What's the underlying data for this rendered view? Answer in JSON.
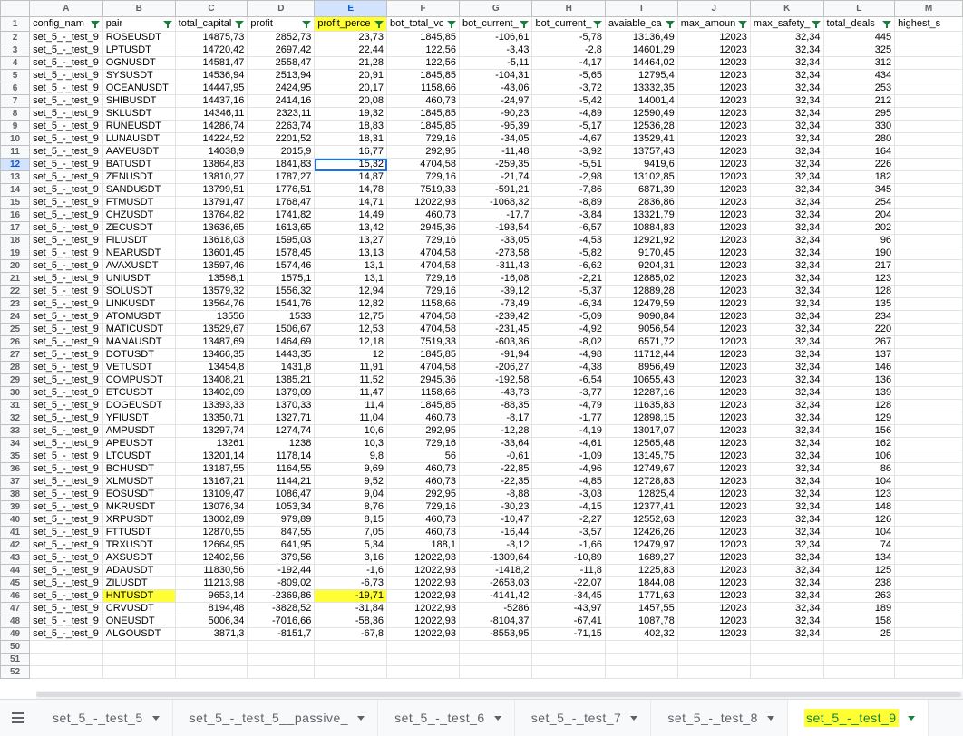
{
  "columns": [
    "A",
    "B",
    "C",
    "D",
    "E",
    "F",
    "G",
    "H",
    "I",
    "J",
    "K",
    "L",
    "M"
  ],
  "header": [
    "config_nam",
    "pair",
    "total_capital",
    "profit",
    "profit_perce",
    "bot_total_vc",
    "bot_current_",
    "bot_current_",
    "avaiable_ca",
    "max_amoun",
    "max_safety_",
    "total_deals",
    "highest_s"
  ],
  "rows": [
    [
      "set_5_-_test_9",
      "ROSEUSDT",
      "14875,73",
      "2852,73",
      "23,73",
      "1845,85",
      "-106,61",
      "-5,78",
      "13136,49",
      "12023",
      "32,34",
      "445"
    ],
    [
      "set_5_-_test_9",
      "LPTUSDT",
      "14720,42",
      "2697,42",
      "22,44",
      "122,56",
      "-3,43",
      "-2,8",
      "14601,29",
      "12023",
      "32,34",
      "325"
    ],
    [
      "set_5_-_test_9",
      "OGNUSDT",
      "14581,47",
      "2558,47",
      "21,28",
      "122,56",
      "-5,11",
      "-4,17",
      "14464,02",
      "12023",
      "32,34",
      "312"
    ],
    [
      "set_5_-_test_9",
      "SYSUSDT",
      "14536,94",
      "2513,94",
      "20,91",
      "1845,85",
      "-104,31",
      "-5,65",
      "12795,4",
      "12023",
      "32,34",
      "434"
    ],
    [
      "set_5_-_test_9",
      "OCEANUSDT",
      "14447,95",
      "2424,95",
      "20,17",
      "1158,66",
      "-43,06",
      "-3,72",
      "13332,35",
      "12023",
      "32,34",
      "253"
    ],
    [
      "set_5_-_test_9",
      "SHIBUSDT",
      "14437,16",
      "2414,16",
      "20,08",
      "460,73",
      "-24,97",
      "-5,42",
      "14001,4",
      "12023",
      "32,34",
      "212"
    ],
    [
      "set_5_-_test_9",
      "SKLUSDT",
      "14346,11",
      "2323,11",
      "19,32",
      "1845,85",
      "-90,23",
      "-4,89",
      "12590,49",
      "12023",
      "32,34",
      "295"
    ],
    [
      "set_5_-_test_9",
      "RUNEUSDT",
      "14286,74",
      "2263,74",
      "18,83",
      "1845,85",
      "-95,39",
      "-5,17",
      "12536,28",
      "12023",
      "32,34",
      "330"
    ],
    [
      "set_5_-_test_9",
      "LUNAUSDT",
      "14224,52",
      "2201,52",
      "18,31",
      "729,16",
      "-34,05",
      "-4,67",
      "13529,41",
      "12023",
      "32,34",
      "280"
    ],
    [
      "set_5_-_test_9",
      "AAVEUSDT",
      "14038,9",
      "2015,9",
      "16,77",
      "292,95",
      "-11,48",
      "-3,92",
      "13757,43",
      "12023",
      "32,34",
      "164"
    ],
    [
      "set_5_-_test_9",
      "BATUSDT",
      "13864,83",
      "1841,83",
      "15,32",
      "4704,58",
      "-259,35",
      "-5,51",
      "9419,6",
      "12023",
      "32,34",
      "226"
    ],
    [
      "set_5_-_test_9",
      "ZENUSDT",
      "13810,27",
      "1787,27",
      "14,87",
      "729,16",
      "-21,74",
      "-2,98",
      "13102,85",
      "12023",
      "32,34",
      "182"
    ],
    [
      "set_5_-_test_9",
      "SANDUSDT",
      "13799,51",
      "1776,51",
      "14,78",
      "7519,33",
      "-591,21",
      "-7,86",
      "6871,39",
      "12023",
      "32,34",
      "345"
    ],
    [
      "set_5_-_test_9",
      "FTMUSDT",
      "13791,47",
      "1768,47",
      "14,71",
      "12022,93",
      "-1068,32",
      "-8,89",
      "2836,86",
      "12023",
      "32,34",
      "254"
    ],
    [
      "set_5_-_test_9",
      "CHZUSDT",
      "13764,82",
      "1741,82",
      "14,49",
      "460,73",
      "-17,7",
      "-3,84",
      "13321,79",
      "12023",
      "32,34",
      "204"
    ],
    [
      "set_5_-_test_9",
      "ZECUSDT",
      "13636,65",
      "1613,65",
      "13,42",
      "2945,36",
      "-193,54",
      "-6,57",
      "10884,83",
      "12023",
      "32,34",
      "202"
    ],
    [
      "set_5_-_test_9",
      "FILUSDT",
      "13618,03",
      "1595,03",
      "13,27",
      "729,16",
      "-33,05",
      "-4,53",
      "12921,92",
      "12023",
      "32,34",
      "96"
    ],
    [
      "set_5_-_test_9",
      "NEARUSDT",
      "13601,45",
      "1578,45",
      "13,13",
      "4704,58",
      "-273,58",
      "-5,82",
      "9170,45",
      "12023",
      "32,34",
      "190"
    ],
    [
      "set_5_-_test_9",
      "AVAXUSDT",
      "13597,46",
      "1574,46",
      "13,1",
      "4704,58",
      "-311,43",
      "-6,62",
      "9204,31",
      "12023",
      "32,34",
      "217"
    ],
    [
      "set_5_-_test_9",
      "UNIUSDT",
      "13598,1",
      "1575,1",
      "13,1",
      "729,16",
      "-16,08",
      "-2,21",
      "12885,02",
      "12023",
      "32,34",
      "123"
    ],
    [
      "set_5_-_test_9",
      "SOLUSDT",
      "13579,32",
      "1556,32",
      "12,94",
      "729,16",
      "-39,12",
      "-5,37",
      "12889,28",
      "12023",
      "32,34",
      "128"
    ],
    [
      "set_5_-_test_9",
      "LINKUSDT",
      "13564,76",
      "1541,76",
      "12,82",
      "1158,66",
      "-73,49",
      "-6,34",
      "12479,59",
      "12023",
      "32,34",
      "135"
    ],
    [
      "set_5_-_test_9",
      "ATOMUSDT",
      "13556",
      "1533",
      "12,75",
      "4704,58",
      "-239,42",
      "-5,09",
      "9090,84",
      "12023",
      "32,34",
      "234"
    ],
    [
      "set_5_-_test_9",
      "MATICUSDT",
      "13529,67",
      "1506,67",
      "12,53",
      "4704,58",
      "-231,45",
      "-4,92",
      "9056,54",
      "12023",
      "32,34",
      "220"
    ],
    [
      "set_5_-_test_9",
      "MANAUSDT",
      "13487,69",
      "1464,69",
      "12,18",
      "7519,33",
      "-603,36",
      "-8,02",
      "6571,72",
      "12023",
      "32,34",
      "267"
    ],
    [
      "set_5_-_test_9",
      "DOTUSDT",
      "13466,35",
      "1443,35",
      "12",
      "1845,85",
      "-91,94",
      "-4,98",
      "11712,44",
      "12023",
      "32,34",
      "137"
    ],
    [
      "set_5_-_test_9",
      "VETUSDT",
      "13454,8",
      "1431,8",
      "11,91",
      "4704,58",
      "-206,27",
      "-4,38",
      "8956,49",
      "12023",
      "32,34",
      "146"
    ],
    [
      "set_5_-_test_9",
      "COMPUSDT",
      "13408,21",
      "1385,21",
      "11,52",
      "2945,36",
      "-192,58",
      "-6,54",
      "10655,43",
      "12023",
      "32,34",
      "136"
    ],
    [
      "set_5_-_test_9",
      "ETCUSDT",
      "13402,09",
      "1379,09",
      "11,47",
      "1158,66",
      "-43,73",
      "-3,77",
      "12287,16",
      "12023",
      "32,34",
      "139"
    ],
    [
      "set_5_-_test_9",
      "DOGEUSDT",
      "13393,33",
      "1370,33",
      "11,4",
      "1845,85",
      "-88,35",
      "-4,79",
      "11635,83",
      "12023",
      "32,34",
      "128"
    ],
    [
      "set_5_-_test_9",
      "YFIUSDT",
      "13350,71",
      "1327,71",
      "11,04",
      "460,73",
      "-8,17",
      "-1,77",
      "12898,15",
      "12023",
      "32,34",
      "129"
    ],
    [
      "set_5_-_test_9",
      "AMPUSDT",
      "13297,74",
      "1274,74",
      "10,6",
      "292,95",
      "-12,28",
      "-4,19",
      "13017,07",
      "12023",
      "32,34",
      "156"
    ],
    [
      "set_5_-_test_9",
      "APEUSDT",
      "13261",
      "1238",
      "10,3",
      "729,16",
      "-33,64",
      "-4,61",
      "12565,48",
      "12023",
      "32,34",
      "162"
    ],
    [
      "set_5_-_test_9",
      "LTCUSDT",
      "13201,14",
      "1178,14",
      "9,8",
      "56",
      "-0,61",
      "-1,09",
      "13145,75",
      "12023",
      "32,34",
      "106"
    ],
    [
      "set_5_-_test_9",
      "BCHUSDT",
      "13187,55",
      "1164,55",
      "9,69",
      "460,73",
      "-22,85",
      "-4,96",
      "12749,67",
      "12023",
      "32,34",
      "86"
    ],
    [
      "set_5_-_test_9",
      "XLMUSDT",
      "13167,21",
      "1144,21",
      "9,52",
      "460,73",
      "-22,35",
      "-4,85",
      "12728,83",
      "12023",
      "32,34",
      "104"
    ],
    [
      "set_5_-_test_9",
      "EOSUSDT",
      "13109,47",
      "1086,47",
      "9,04",
      "292,95",
      "-8,88",
      "-3,03",
      "12825,4",
      "12023",
      "32,34",
      "123"
    ],
    [
      "set_5_-_test_9",
      "MKRUSDT",
      "13076,34",
      "1053,34",
      "8,76",
      "729,16",
      "-30,23",
      "-4,15",
      "12377,41",
      "12023",
      "32,34",
      "148"
    ],
    [
      "set_5_-_test_9",
      "XRPUSDT",
      "13002,89",
      "979,89",
      "8,15",
      "460,73",
      "-10,47",
      "-2,27",
      "12552,63",
      "12023",
      "32,34",
      "126"
    ],
    [
      "set_5_-_test_9",
      "FTTUSDT",
      "12870,55",
      "847,55",
      "7,05",
      "460,73",
      "-16,44",
      "-3,57",
      "12426,26",
      "12023",
      "32,34",
      "104"
    ],
    [
      "set_5_-_test_9",
      "TRXUSDT",
      "12664,95",
      "641,95",
      "5,34",
      "188,1",
      "-3,12",
      "-1,66",
      "12479,97",
      "12023",
      "32,34",
      "74"
    ],
    [
      "set_5_-_test_9",
      "AXSUSDT",
      "12402,56",
      "379,56",
      "3,16",
      "12022,93",
      "-1309,64",
      "-10,89",
      "1689,27",
      "12023",
      "32,34",
      "134"
    ],
    [
      "set_5_-_test_9",
      "ADAUSDT",
      "11830,56",
      "-192,44",
      "-1,6",
      "12022,93",
      "-1418,2",
      "-11,8",
      "1225,83",
      "12023",
      "32,34",
      "125"
    ],
    [
      "set_5_-_test_9",
      "ZILUSDT",
      "11213,98",
      "-809,02",
      "-6,73",
      "12022,93",
      "-2653,03",
      "-22,07",
      "1844,08",
      "12023",
      "32,34",
      "238"
    ],
    [
      "set_5_-_test_9",
      "HNTUSDT",
      "9653,14",
      "-2369,86",
      "-19,71",
      "12022,93",
      "-4141,42",
      "-34,45",
      "1771,63",
      "12023",
      "32,34",
      "263"
    ],
    [
      "set_5_-_test_9",
      "CRVUSDT",
      "8194,48",
      "-3828,52",
      "-31,84",
      "12022,93",
      "-5286",
      "-43,97",
      "1457,55",
      "12023",
      "32,34",
      "189"
    ],
    [
      "set_5_-_test_9",
      "ONEUSDT",
      "5006,34",
      "-7016,66",
      "-58,36",
      "12022,93",
      "-8104,37",
      "-67,41",
      "1087,78",
      "12023",
      "32,34",
      "158"
    ],
    [
      "set_5_-_test_9",
      "ALGOUSDT",
      "3871,3",
      "-8151,7",
      "-67,8",
      "12022,93",
      "-8553,95",
      "-71,15",
      "402,32",
      "12023",
      "32,34",
      "25"
    ]
  ],
  "empty_row_numbers": [
    50,
    51,
    52
  ],
  "selected_cell": {
    "row": 12,
    "col": "E"
  },
  "highlighted_row": 46,
  "highlight_color": "#ffff33",
  "tabs": [
    {
      "label": "set_5_-_test_5",
      "active": false
    },
    {
      "label": "set_5_-_test_5__passive_",
      "active": false
    },
    {
      "label": "set_5_-_test_6",
      "active": false
    },
    {
      "label": "set_5_-_test_7",
      "active": false
    },
    {
      "label": "set_5_-_test_8",
      "active": false
    },
    {
      "label": "set_5_-_test_9",
      "active": true
    }
  ],
  "icons": {
    "sheets_menu": "hamburger-icon",
    "filter": "filter-icon",
    "tab_menu": "caret-down-icon"
  }
}
